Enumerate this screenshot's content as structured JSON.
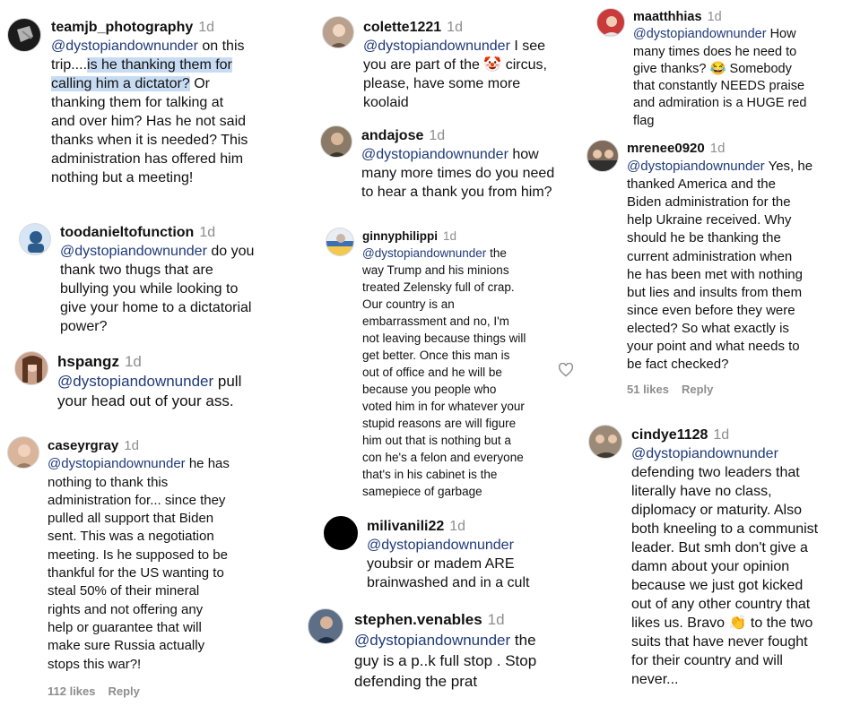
{
  "time_label": "1d",
  "col1": {
    "c1": {
      "user": "teamjb_photography",
      "mention": "@dystopiandownunder",
      "lines": [
        "on this",
        "trip....",
        "is he thanking them for",
        "calling him a dictator?",
        "Or",
        "thanking them for talking at",
        "and over him? Has he not said",
        "thanks when it is needed? This",
        "administration has offered him",
        "nothing but a meeting!"
      ]
    },
    "c2": {
      "user": "toodanieltofunction",
      "mention": "@dystopiandownunder",
      "lines": [
        "do you",
        "thank two thugs that are",
        "bullying you while looking to",
        "give your home to a dictatorial",
        "power?"
      ]
    },
    "c3": {
      "user": "hspangz",
      "mention": "@dystopiandownunder",
      "lines": [
        "pull",
        "your head out of your ass."
      ]
    },
    "c4": {
      "user": "caseyrgray",
      "mention": "@dystopiandownunder",
      "lines": [
        "he has",
        "nothing to thank this",
        "administration for... since they",
        "pulled all support that Biden",
        "sent. This was a negotiation",
        "meeting. Is he supposed to be",
        "thankful for the US wanting to",
        "steal 50% of their mineral",
        "rights and not offering any",
        "help or guarantee that will",
        "make sure Russia actually",
        "stops this war?!"
      ],
      "likes": "112 likes",
      "reply": "Reply"
    }
  },
  "col2": {
    "c1": {
      "user": "colette1221",
      "mention": "@dystopiandownunder",
      "lines": [
        "I see",
        "you are part of the",
        "🤡",
        "circus,",
        "please, have some more",
        "koolaid"
      ]
    },
    "c2": {
      "user": "andajose",
      "mention": "@dystopiandownunder",
      "lines": [
        "how",
        "many more times do you need",
        "to hear a thank you from him?"
      ]
    },
    "c3": {
      "user": "ginnyphilippi",
      "mention": "@dystopiandownunder",
      "lines": [
        "the",
        "way Trump and his minions",
        "treated Zelensky full of crap.",
        "Our country is an",
        "embarrassment and no, I'm",
        "not leaving because things will",
        "get better. Once this man is",
        "out of office and he will be",
        "because you people who",
        "voted him in for whatever your",
        "stupid reasons are will figure",
        "him out that is nothing but a",
        "con he's a felon and everyone",
        "that's in his cabinet is the",
        "samepiece of garbage"
      ],
      "heart_icon": "heart-outline"
    },
    "c4": {
      "user": "milivanili22",
      "mention": "@dystopiandownunder",
      "lines": [
        "youbsir or madem ARE",
        "brainwashed and in a cult"
      ]
    },
    "c5": {
      "user": "stephen.venables",
      "mention": "@dystopiandownunder",
      "lines": [
        "the",
        "guy is a p..k full stop . Stop",
        "defending the prat"
      ]
    }
  },
  "col3": {
    "c1": {
      "user": "maatthhias",
      "mention": "@dystopiandownunder",
      "lines": [
        "How",
        "many times does he need to",
        "give thanks?",
        "😂",
        "Somebody",
        "that constantly NEEDS praise",
        "and admiration is a HUGE red",
        "flag"
      ]
    },
    "c2": {
      "user": "mrenee0920",
      "mention": "@dystopiandownunder",
      "lines": [
        "Yes, he",
        "thanked America and the",
        "Biden administration for the",
        "help Ukraine received. Why",
        "should he be thanking the",
        "current administration when",
        "he has been met with nothing",
        "but lies and insults from them",
        "since even before they were",
        "elected? So what exactly is",
        "your point and what needs to",
        "be fact checked?"
      ],
      "likes": "51 likes",
      "reply": "Reply"
    },
    "c3": {
      "user": "cindye1128",
      "mention": "@dystopiandownunder",
      "lines": [
        "defending two leaders that",
        "literally have no class,",
        "diplomacy or maturity. Also",
        "both kneeling to a communist",
        "leader. But smh don't give a",
        "damn about your opinion",
        "because we just got kicked",
        "out of any other country that",
        "likes us. Bravo",
        "👏",
        "to the two",
        "suits that have never fought",
        "for their country and will",
        "never..."
      ]
    }
  }
}
